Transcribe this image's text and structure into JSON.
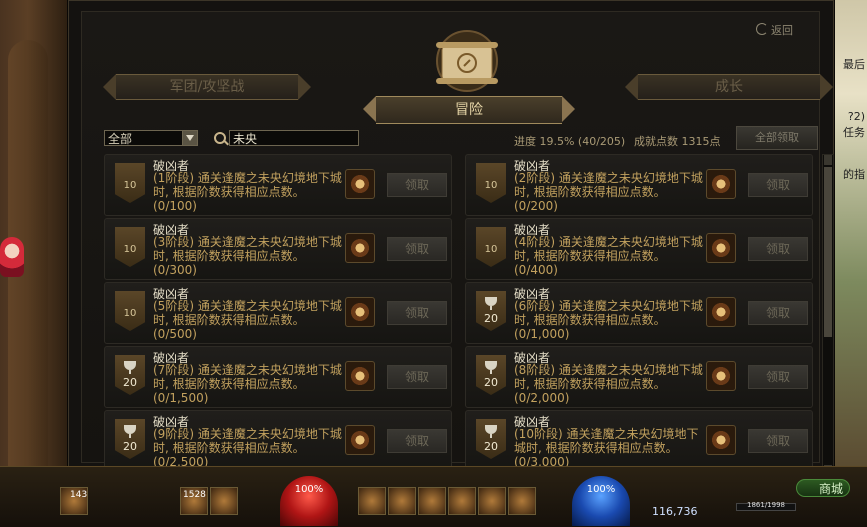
{
  "header": {
    "back_label": "返回"
  },
  "tabs": {
    "left": "军团/攻坚战",
    "active": "冒险",
    "right": "成长"
  },
  "filter": {
    "category": "全部",
    "search_value": "未央"
  },
  "stats": {
    "progress": "进度 19.5% (40/205)",
    "points": "成就点数 1315点",
    "claim_all": "全部领取"
  },
  "achievements": [
    {
      "title": "破凶者",
      "desc": "(1阶段) 通关逢魔之未央幻境地下城时, 根据阶数获得相应点数。",
      "count": "(0/100)",
      "badge": "10",
      "trophy": false,
      "claim": "领取"
    },
    {
      "title": "破凶者",
      "desc": "(2阶段) 通关逢魔之未央幻境地下城时, 根据阶数获得相应点数。",
      "count": "(0/200)",
      "badge": "10",
      "trophy": false,
      "claim": "领取"
    },
    {
      "title": "破凶者",
      "desc": "(3阶段) 通关逢魔之未央幻境地下城时, 根据阶数获得相应点数。",
      "count": "(0/300)",
      "badge": "10",
      "trophy": false,
      "claim": "领取"
    },
    {
      "title": "破凶者",
      "desc": "(4阶段) 通关逢魔之未央幻境地下城时, 根据阶数获得相应点数。",
      "count": "(0/400)",
      "badge": "10",
      "trophy": false,
      "claim": "领取"
    },
    {
      "title": "破凶者",
      "desc": "(5阶段) 通关逢魔之未央幻境地下城时, 根据阶数获得相应点数。",
      "count": "(0/500)",
      "badge": "10",
      "trophy": false,
      "claim": "领取"
    },
    {
      "title": "破凶者",
      "desc": "(6阶段) 通关逢魔之未央幻境地下城时, 根据阶数获得相应点数。",
      "count": "(0/1,000)",
      "badge": "20",
      "trophy": true,
      "claim": "领取"
    },
    {
      "title": "破凶者",
      "desc": "(7阶段) 通关逢魔之未央幻境地下城时, 根据阶数获得相应点数。",
      "count": "(0/1,500)",
      "badge": "20",
      "trophy": true,
      "claim": "领取"
    },
    {
      "title": "破凶者",
      "desc": "(8阶段) 通关逢魔之未央幻境地下城时, 根据阶数获得相应点数。",
      "count": "(0/2,000)",
      "badge": "20",
      "trophy": true,
      "claim": "领取"
    },
    {
      "title": "破凶者",
      "desc": "(9阶段) 通关逢魔之未央幻境地下城时, 根据阶数获得相应点数。",
      "count": "(0/2,500)",
      "badge": "20",
      "trophy": true,
      "claim": "领取"
    },
    {
      "title": "破凶者",
      "desc": "(10阶段) 通关逢魔之未央幻境地下城时, 根据阶数获得相应点数。",
      "count": "(0/3,000)",
      "badge": "20",
      "trophy": true,
      "claim": "领取"
    }
  ],
  "scene": {
    "right_text_1": "最后",
    "right_text_2": "?2)",
    "right_text_3": "任务",
    "right_text_4": "的指"
  },
  "hud": {
    "hp": "100%",
    "mp": "100%",
    "slot1_num": "143",
    "slot2_num": "1528",
    "gold": "116,736",
    "shop": "商城",
    "exp": "1861/1998"
  }
}
